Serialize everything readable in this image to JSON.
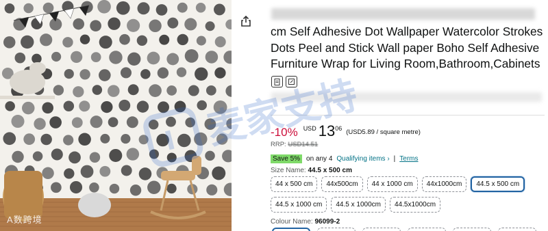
{
  "image": {
    "watermark_brand": "A数跨境",
    "wall_pattern": "watercolor-dots",
    "colors": {
      "dot": "#2c2c2c",
      "wall": "#f3f1ec",
      "floor": "#b07a4a"
    }
  },
  "share_icon": "share-icon",
  "title": {
    "lines": [
      "cm Self Adhesive Dot Wallpaper Watercolor Strokes",
      "Dots Peel and Stick Wall paper Boho Self Adhesive",
      "Furniture Wrap for Living Room,Bathroom,Cabinets"
    ]
  },
  "icons": [
    "clipboard-icon",
    "edit-icon"
  ],
  "price": {
    "discount": "-10%",
    "currency": "USD",
    "whole": "13",
    "fraction": "06",
    "unit_price": "(USD5.89 / square metre)"
  },
  "rrp": {
    "label": "RRP:",
    "value": "USD14.51"
  },
  "promo": {
    "badge": "Save 5%",
    "text": "on any 4",
    "qualifying": "Qualifying items ›",
    "separator": "|",
    "terms": "Terms"
  },
  "size": {
    "label": "Size Name:",
    "selected": "44.5 x 500 cm",
    "rows": [
      [
        "44 x 500 cm",
        "44x500cm",
        "44 x 1000 cm",
        "44x1000cm",
        "44.5 x 500 cm"
      ],
      [
        "44.5 x 1000 cm",
        "44.5 x 1000cm",
        "44.5x1000cm"
      ]
    ]
  },
  "colour": {
    "label": "Colour Name:",
    "selected": "96099-2"
  },
  "watermark_text": "麦家支持",
  "colors": {
    "accent": "#2162a1",
    "discount": "#cc0c39",
    "link": "#007185",
    "badge": "#7fda69"
  }
}
